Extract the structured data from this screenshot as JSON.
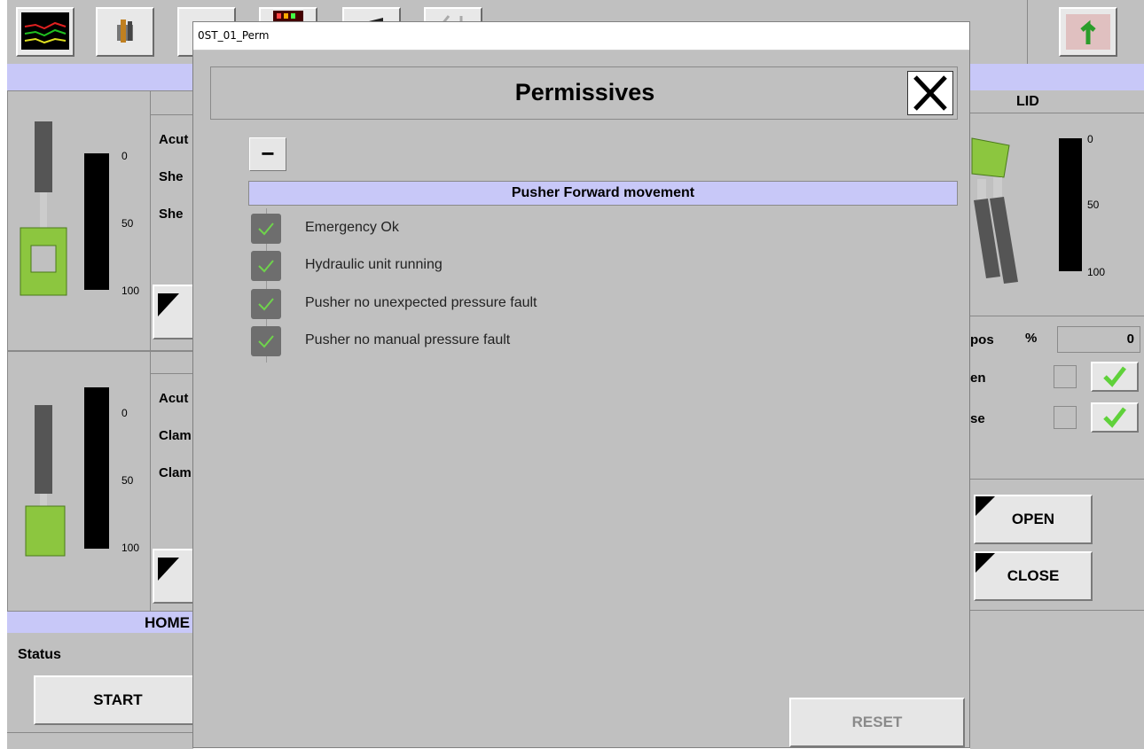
{
  "toolbar": {
    "buttons": [
      "trend-icon",
      "maintenance-icon",
      "screen-icon",
      "alarm-panel-icon",
      "tool-icon",
      "wrench-icon"
    ],
    "right_button": "export-icon"
  },
  "background": {
    "left_panel1": {
      "gauge_ticks": [
        "0",
        "50",
        "100"
      ],
      "labels": [
        "Acut",
        "She",
        "She"
      ]
    },
    "left_panel2": {
      "gauge_ticks": [
        "0",
        "50",
        "100"
      ],
      "labels": [
        "Acut",
        "Clam",
        "Clam"
      ]
    },
    "home_label": "HOME",
    "status_label": "Status",
    "start_label": "START",
    "lid": {
      "title": "LID",
      "gauge_ticks": [
        "0",
        "50",
        "100"
      ],
      "pos_label": "pos",
      "pos_unit": "%",
      "pos_value": "0",
      "open_row_label": "en",
      "close_row_label": "se",
      "open_button": "OPEN",
      "close_button": "CLOSE"
    }
  },
  "modal": {
    "window_title": "0ST_01_Perm",
    "header": "Permissives",
    "collapse_symbol": "−",
    "section_title": "Pusher Forward movement",
    "items": [
      {
        "label": "Emergency Ok",
        "ok": true
      },
      {
        "label": "Hydraulic unit running",
        "ok": true
      },
      {
        "label": "Pusher no unexpected pressure fault",
        "ok": true
      },
      {
        "label": "Pusher no manual pressure fault",
        "ok": true
      }
    ],
    "reset_label": "RESET"
  },
  "colors": {
    "panel": "#c0c0c0",
    "lavender": "#c8c8f8",
    "check_green": "#6fd34c",
    "actuator_green": "#8cc63f"
  }
}
